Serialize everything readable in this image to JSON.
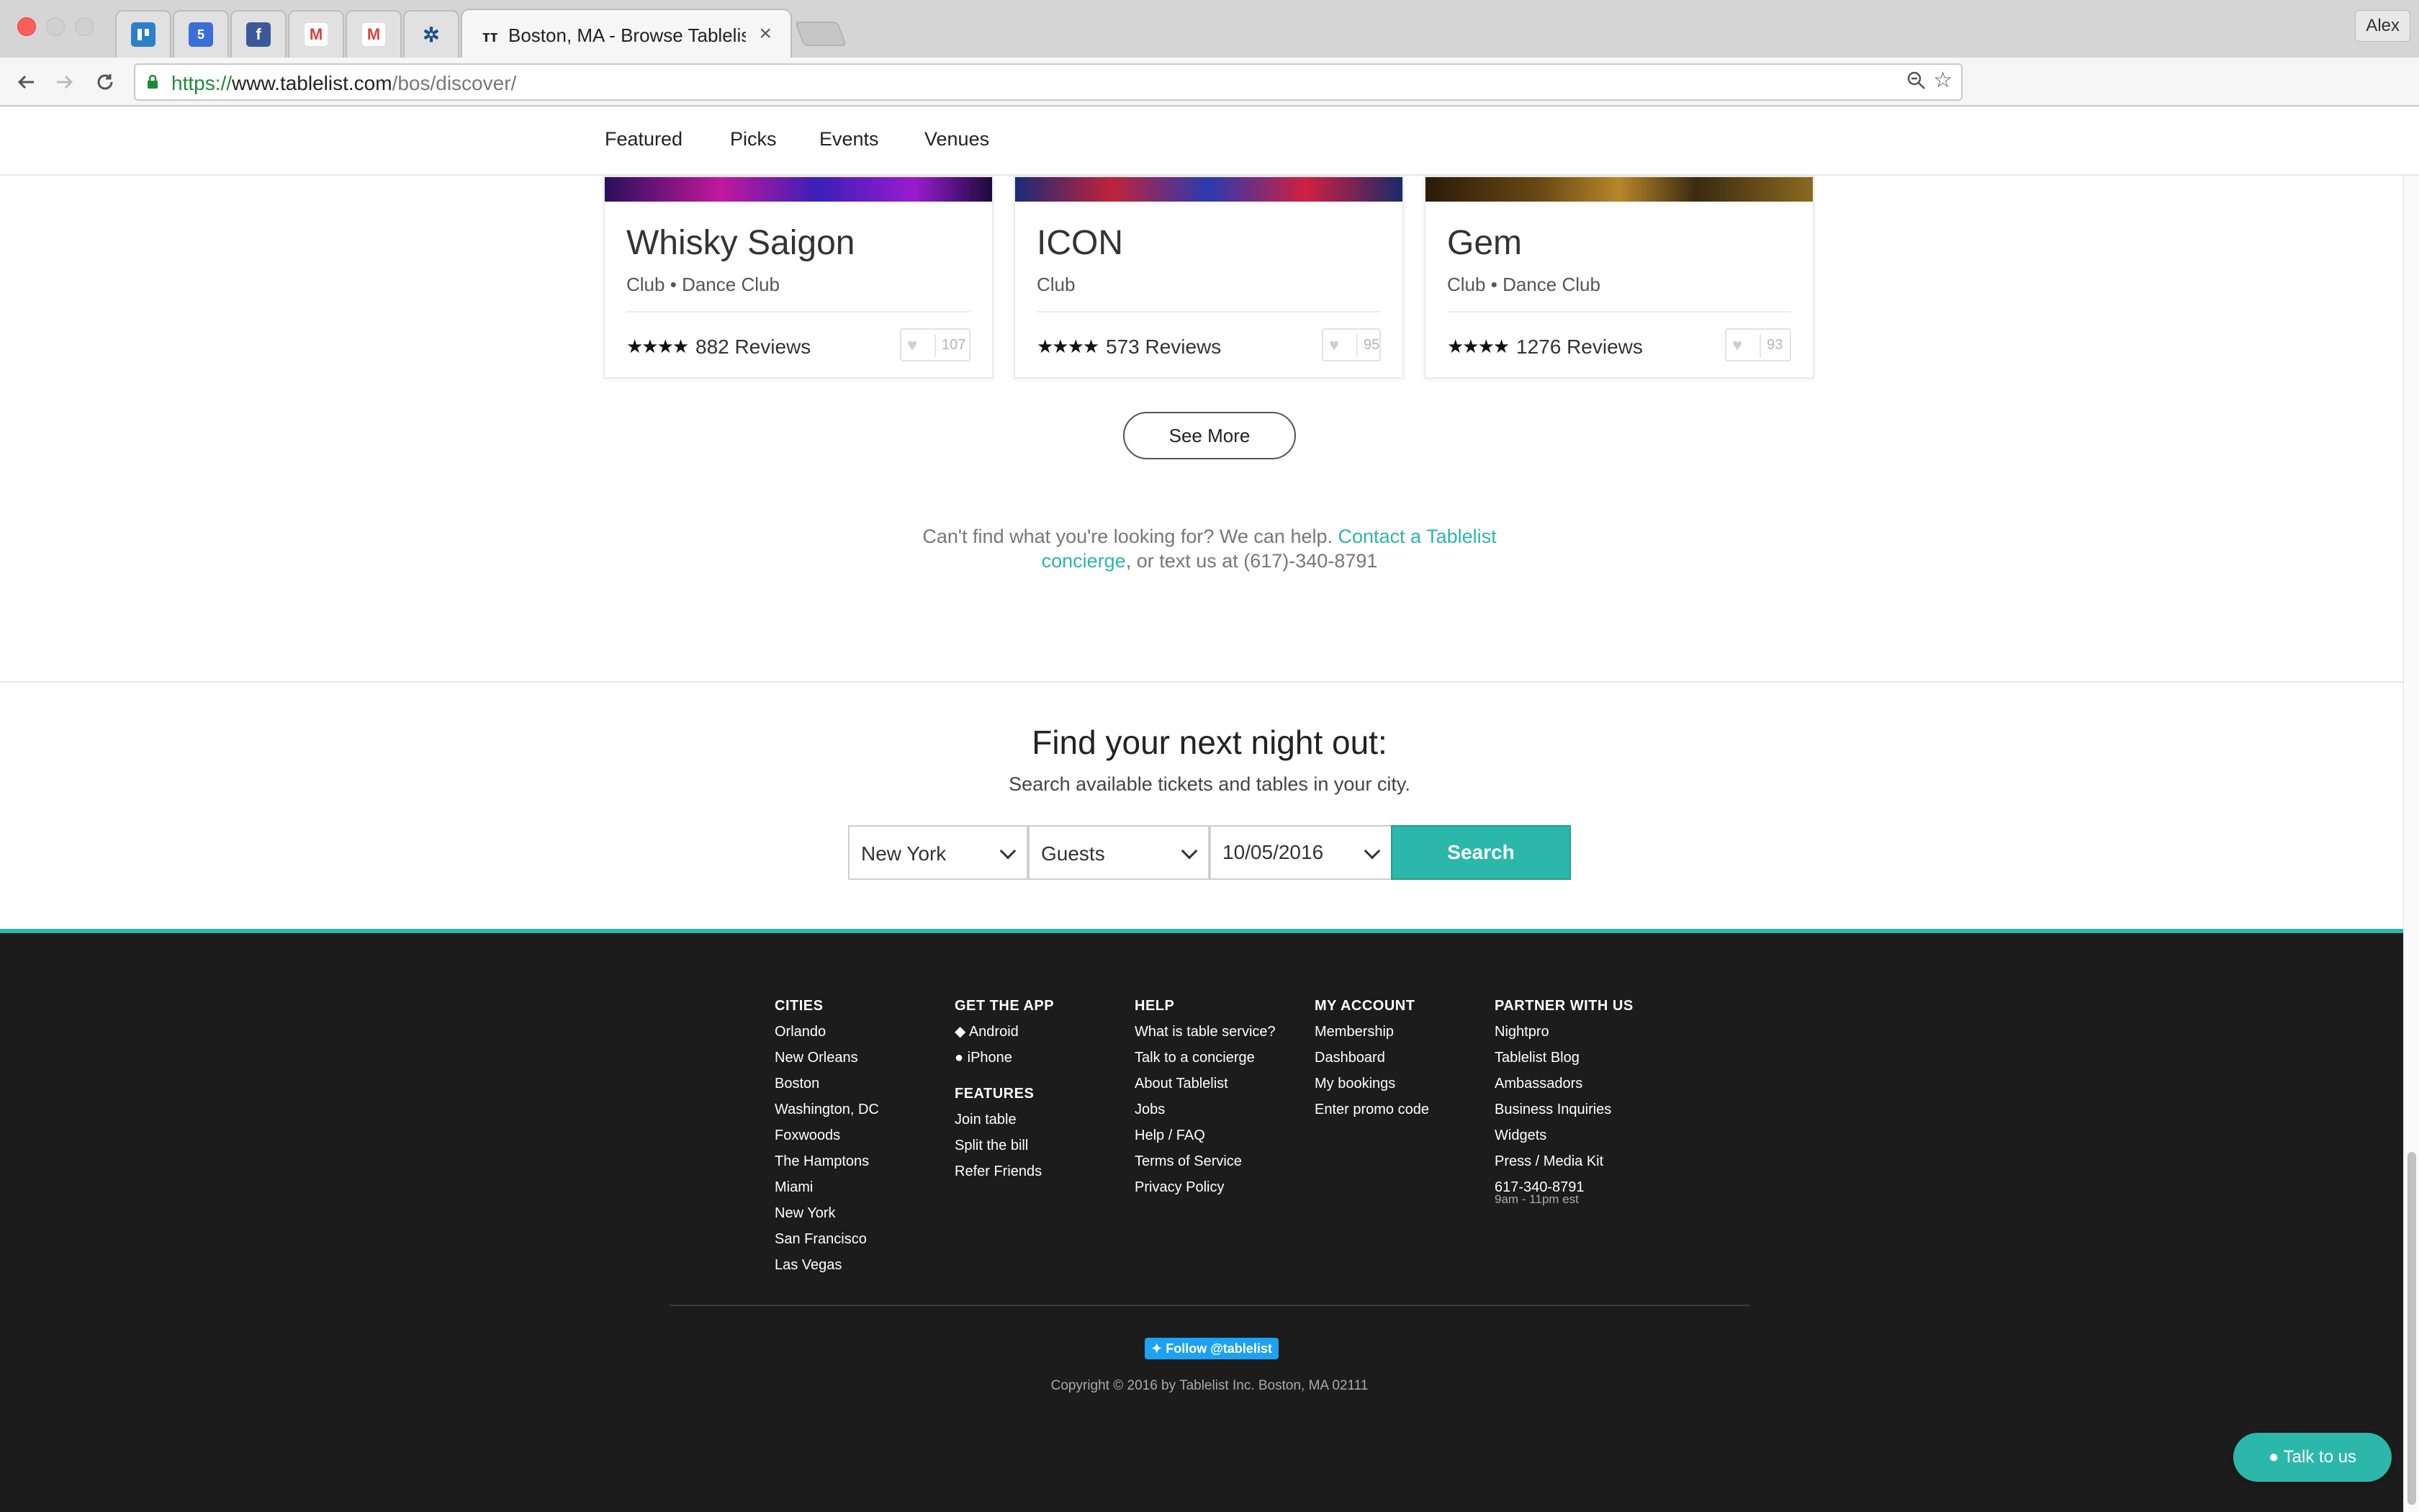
{
  "browser": {
    "active_tab_title": "Boston, MA - Browse Tablelist",
    "tab_close": "×",
    "url_scheme": "https://",
    "url_host": "www.tablelist.com",
    "url_path": "/bos/discover/",
    "profile_name": "Alex",
    "pinned_tabs": [
      "trello-icon",
      "calendar-icon",
      "facebook-icon",
      "gmail-icon",
      "gmail-icon",
      "extension-icon"
    ],
    "calendar_badge": "5",
    "facebook_badge": "f",
    "gmail_badge": "M"
  },
  "subnav": {
    "featured": "Featured",
    "picks": "Picks",
    "events": "Events",
    "venues": "Venues"
  },
  "venues": [
    {
      "name": "Whisky Saigon",
      "type": "Club",
      "subtype": "Dance Club",
      "stars": "★★★★",
      "reviews": "882 Reviews",
      "favorites": "107"
    },
    {
      "name": "ICON",
      "type": "Club",
      "subtype": "",
      "stars": "★★★★",
      "reviews": "573 Reviews",
      "favorites": "95"
    },
    {
      "name": "Gem",
      "type": "Club",
      "subtype": "Dance Club",
      "stars": "★★★★",
      "reviews": "1276 Reviews",
      "favorites": "93"
    }
  ],
  "tag_separator": "•",
  "see_more": "See More",
  "help": {
    "prefix": "Can't find what you're looking for? We can help. ",
    "link_text": "Contact a Tablelist concierge",
    "suffix": ", or text us at (617)-340-8791"
  },
  "search": {
    "title": "Find your next night out:",
    "subtitle": "Search available tickets and tables in your city.",
    "city": "New York",
    "guests": "Guests",
    "date": "10/05/2016",
    "button": "Search"
  },
  "footer": {
    "cities": {
      "heading": "CITIES",
      "items": [
        "Orlando",
        "New Orleans",
        "Boston",
        "Washington, DC",
        "Foxwoods",
        "The Hamptons",
        "Miami",
        "New York",
        "San Francisco",
        "Las Vegas"
      ]
    },
    "app": {
      "heading": "GET THE APP",
      "items": [
        "Android",
        "iPhone"
      ]
    },
    "features": {
      "heading": "FEATURES",
      "items": [
        "Join table",
        "Split the bill",
        "Refer Friends"
      ]
    },
    "help": {
      "heading": "HELP",
      "items": [
        "What is table service?",
        "Talk to a concierge",
        "About Tablelist",
        "Jobs",
        "Help / FAQ",
        "Terms of Service",
        "Privacy Policy"
      ]
    },
    "account": {
      "heading": "MY ACCOUNT",
      "items": [
        "Membership",
        "Dashboard",
        "My bookings",
        "Enter promo code"
      ]
    },
    "partner": {
      "heading": "PARTNER WITH US",
      "items": [
        "Nightpro",
        "Tablelist Blog",
        "Ambassadors",
        "Business Inquiries",
        "Widgets",
        "Press / Media Kit",
        "617-340-8791"
      ],
      "hours": "9am - 11pm est"
    },
    "twitter": "Follow @tablelist",
    "copyright": "Copyright © 2016 by Tablelist Inc. Boston, MA 02111"
  },
  "chat": {
    "label": "Talk to us"
  },
  "colors": {
    "accent": "#2bb8aa",
    "footer_bg": "#1c1c1c",
    "link": "#2cb5a8"
  }
}
